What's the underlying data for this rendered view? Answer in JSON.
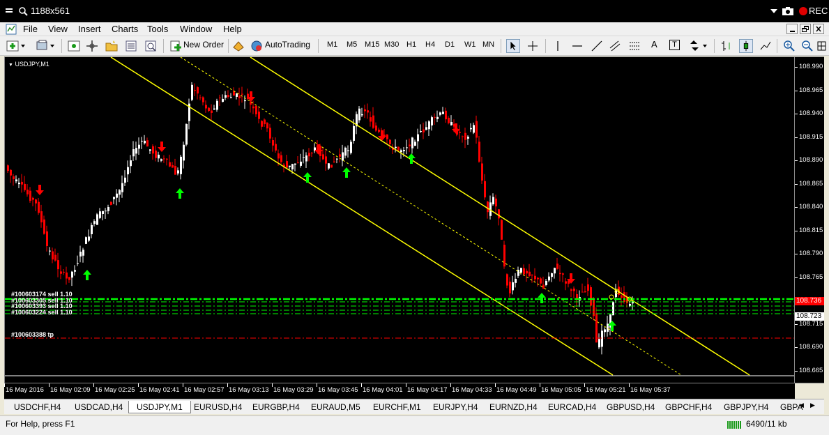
{
  "window": {
    "title": "1188x561",
    "rec_label": "REC"
  },
  "menu": [
    "File",
    "View",
    "Insert",
    "Charts",
    "Tools",
    "Window",
    "Help"
  ],
  "toolbar": {
    "new_order": "New Order",
    "autotrading": "AutoTrading",
    "timeframes": [
      "M1",
      "M5",
      "M15",
      "M30",
      "H1",
      "H4",
      "D1",
      "W1",
      "MN"
    ],
    "text_tool": "A",
    "text_label_tool": "T"
  },
  "chart": {
    "symbol_label": "USDJPY,M1",
    "price_ticks": [
      "108.990",
      "108.965",
      "108.940",
      "108.915",
      "108.890",
      "108.865",
      "108.840",
      "108.815",
      "108.790",
      "108.765",
      "108.740",
      "108.715",
      "108.690",
      "108.665"
    ],
    "current_price": "108.736",
    "level_price": "108.723",
    "order_labels": [
      "#100603174 sell 1.10",
      "#100603305 sell 1.10",
      "#100603393 sell 1.10",
      "#100603224 sell 1.10",
      "#100603388 tp"
    ],
    "time_labels": [
      "16 May 2016",
      "16 May 02:09",
      "16 May 02:25",
      "16 May 02:41",
      "16 May 02:57",
      "16 May 03:13",
      "16 May 03:29",
      "16 May 03:45",
      "16 May 04:01",
      "16 May 04:17",
      "16 May 04:33",
      "16 May 04:49",
      "16 May 05:05",
      "16 May 05:21",
      "16 May 05:37"
    ],
    "colors": {
      "bull": "#ffffff",
      "bear": "#ff0000",
      "channel": "#ffff00",
      "order_line": "#00ff00",
      "tp_line": "#ff0000",
      "up_arrow": "#00ff00",
      "down_arrow": "#ff0000",
      "price_tag": "#ff0000"
    }
  },
  "tabs": [
    "USDCHF,H4",
    "USDCAD,H4",
    "USDJPY,M1",
    "EURUSD,H4",
    "EURGBP,H4",
    "EURAUD,M5",
    "EURCHF,M1",
    "EURJPY,H4",
    "EURNZD,H4",
    "EURCAD,H4",
    "GBPUSD,H4",
    "GBPCHF,H4",
    "GBPJPY,H4",
    "GBPA"
  ],
  "active_tab": "USDJPY,M1",
  "status": {
    "help": "For Help, press F1",
    "traffic": "6490/11 kb"
  }
}
